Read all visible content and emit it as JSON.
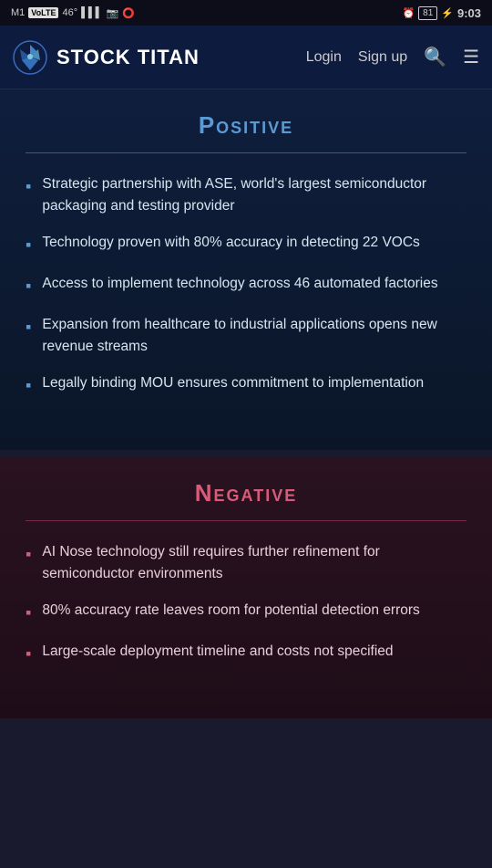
{
  "statusBar": {
    "left": "M1  VoLTE  46°  signal  Instagram  Instagram2",
    "leftText": "M1 VoLTE 46°",
    "battery": "81",
    "time": "9:03"
  },
  "navbar": {
    "logoText": "STOCK TITAN",
    "loginLabel": "Login",
    "signupLabel": "Sign up"
  },
  "positive": {
    "title": "Positive",
    "divider": true,
    "bullets": [
      "Strategic partnership with ASE, world's largest semiconductor packaging and testing provider",
      "Technology proven with 80% accuracy in detecting 22 VOCs",
      "Access to implement technology across 46 automated factories",
      "Expansion from healthcare to industrial applications opens new revenue streams",
      "Legally binding MOU ensures commitment to implementation"
    ]
  },
  "negative": {
    "title": "Negative",
    "divider": true,
    "bullets": [
      "AI Nose technology still requires further refinement for semiconductor environments",
      "80% accuracy rate leaves room for potential detection errors",
      "Large-scale deployment timeline and costs not specified"
    ]
  }
}
